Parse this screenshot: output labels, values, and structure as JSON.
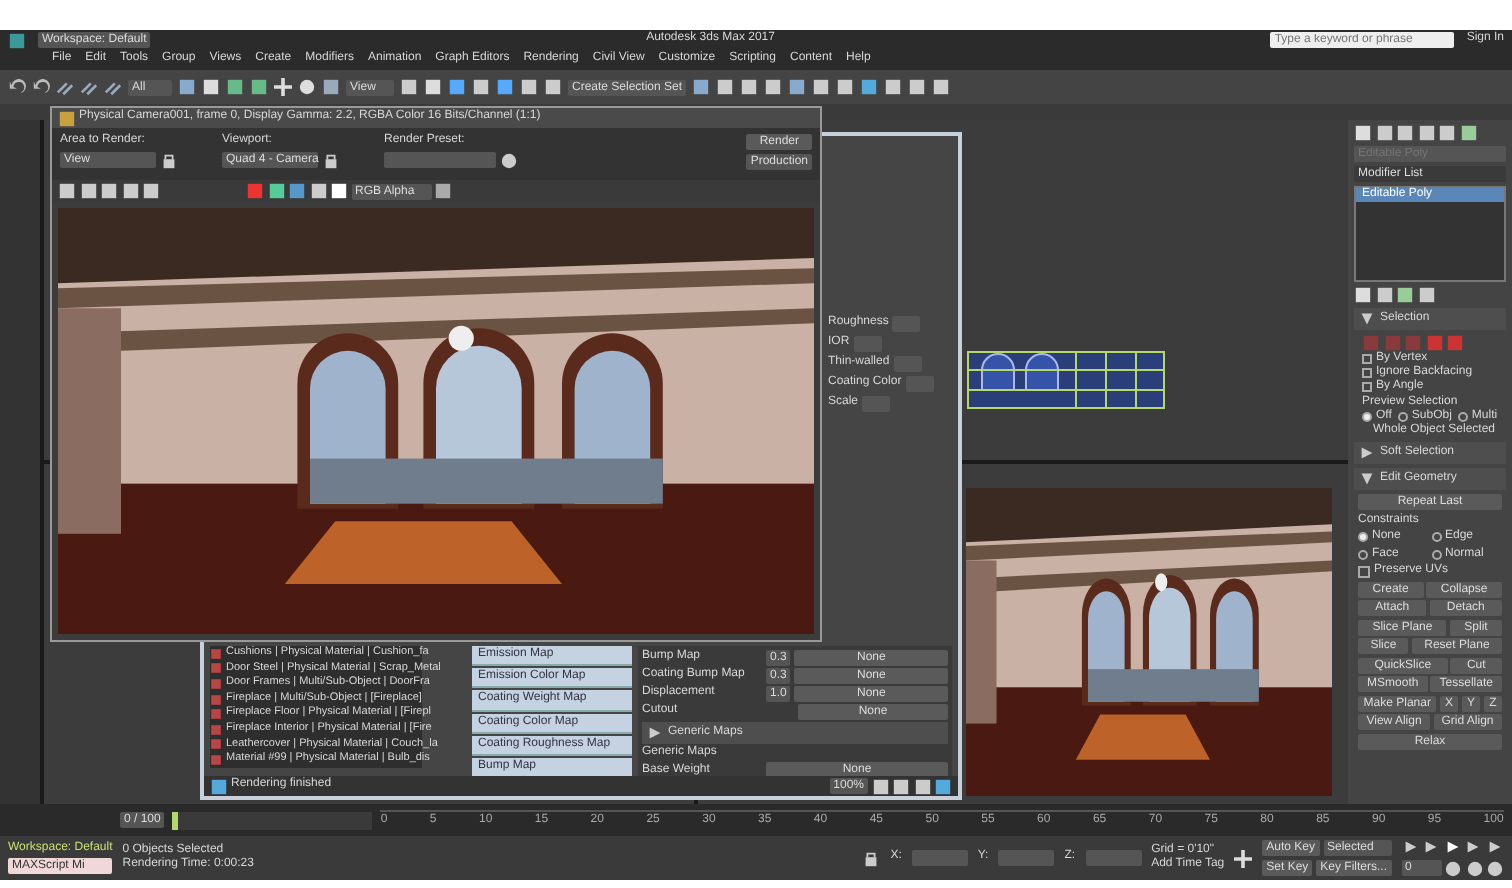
{
  "title_bar": {
    "workspace": "Workspace: Default",
    "title": "Autodesk 3ds Max 2017",
    "search_placeholder": "Type a keyword or phrase",
    "user": "Sign In"
  },
  "menu": [
    "File",
    "Edit",
    "Tools",
    "Group",
    "Views",
    "Create",
    "Modifiers",
    "Animation",
    "Graph Editors",
    "Rendering",
    "Civil View",
    "Customize",
    "Scripting",
    "Content",
    "Help"
  ],
  "toolbar": {
    "filter": "All",
    "view": "View",
    "selection_set": "Create Selection Set"
  },
  "frame_window": {
    "title": "Physical Camera001, frame 0, Display Gamma: 2.2, RGBA Color 16 Bits/Channel (1:1)",
    "area_label": "Area to Render:",
    "area_value": "View",
    "viewport_label": "Viewport:",
    "viewport_value": "Quad 4 - Camera",
    "preset_label": "Render Preset:",
    "render_button": "Render",
    "mode": "Production",
    "channel": "RGB Alpha"
  },
  "material_editor": {
    "side_labels": [
      "Roughness",
      "IOR",
      "Thin-walled",
      "Coating Color",
      "Scale"
    ],
    "materials": [
      {
        "label": "Cushions | Physical Material | Cushion_fa"
      },
      {
        "label": "Door Steel | Physical Material | Scrap_Metal"
      },
      {
        "label": "Door Frames | Multi/Sub-Object | DoorFra"
      },
      {
        "label": "Fireplace | Multi/Sub-Object | [Fireplace]"
      },
      {
        "label": "Fireplace Floor | Physical Material | [Firepl"
      },
      {
        "label": "Fireplace Interior | Physical Material | [Fire"
      },
      {
        "label": "Leathercover | Physical Material | Couch_la"
      },
      {
        "label": "Material #99 | Physical Material | Bulb_dis"
      }
    ],
    "maps": [
      "Emission Map",
      "Emission Color Map",
      "Coating Weight Map",
      "Coating Color Map",
      "Coating Roughness Map",
      "Bump Map"
    ],
    "params": [
      {
        "label": "Bump Map",
        "value": "0.3",
        "button": "None"
      },
      {
        "label": "Coating Bump Map",
        "value": "0.3",
        "button": "None"
      },
      {
        "label": "Displacement",
        "value": "1.0",
        "button": "None"
      },
      {
        "label": "Cutout",
        "button": "None"
      }
    ],
    "section": "Generic Maps",
    "section_sub": "Generic Maps",
    "section_param": {
      "label": "Base Weight",
      "button": "None"
    },
    "status": "Rendering finished",
    "zoom": "100%"
  },
  "command_panel": {
    "name_placeholder": "Editable Poly",
    "modifier_list": "Modifier List",
    "stack": [
      {
        "label": "Editable Poly",
        "selected": true
      }
    ],
    "rollouts": [
      {
        "title": "Selection",
        "expanded": true
      },
      {
        "title": "Soft Selection",
        "expanded": false
      },
      {
        "title": "Edit Geometry",
        "expanded": true
      }
    ],
    "selection_options": [
      {
        "label": "By Vertex",
        "checked": false
      },
      {
        "label": "Ignore Backfacing",
        "checked": false
      },
      {
        "label": "By Angle",
        "checked": false
      }
    ],
    "preview_label": "Preview Selection",
    "preview": [
      {
        "label": "Off",
        "selected": true
      },
      {
        "label": "SubObj",
        "selected": false
      },
      {
        "label": "Multi",
        "selected": false
      }
    ],
    "whole": "Whole Object Selected",
    "repeat": "Repeat Last",
    "constraints_label": "Constraints",
    "constraints": [
      {
        "label": "None",
        "selected": true
      },
      {
        "label": "Edge",
        "selected": false
      },
      {
        "label": "Face",
        "selected": false
      },
      {
        "label": "Normal",
        "selected": false
      }
    ],
    "preserve": {
      "label": "Preserve UVs",
      "checked": false
    },
    "buttons": [
      [
        "Create",
        "Collapse"
      ],
      [
        "Attach",
        "Detach"
      ],
      [
        "Slice Plane",
        "Split"
      ],
      [
        "Slice",
        "Reset Plane"
      ],
      [
        "QuickSlice",
        "Cut"
      ],
      [
        "MSmooth",
        "Tessellate"
      ],
      [
        "Make Planar",
        "X",
        "Y",
        "Z"
      ],
      [
        "View Align",
        "Grid Align"
      ],
      [
        "Relax"
      ]
    ]
  },
  "timeline": {
    "slider": "0 / 100",
    "level": 0,
    "ticks": [
      "0",
      "5",
      "10",
      "15",
      "20",
      "25",
      "30",
      "35",
      "40",
      "45",
      "50",
      "55",
      "60",
      "65",
      "70",
      "75",
      "80",
      "85",
      "90",
      "95",
      "100"
    ]
  },
  "status_bar": {
    "workspace": "Workspace: Default",
    "script": "MAXScript Mi",
    "selected": "0 Objects Selected",
    "time": "Rendering Time: 0:00:23",
    "x_label": "X:",
    "y_label": "Y:",
    "z_label": "Z:",
    "grid": "Grid = 0'10\"",
    "add_time_tag": "Add Time Tag",
    "auto_key": "Auto Key",
    "key_mode": "Selected",
    "set_key": "Set Key",
    "key_filters": "Key Filters...",
    "frame": "0"
  }
}
